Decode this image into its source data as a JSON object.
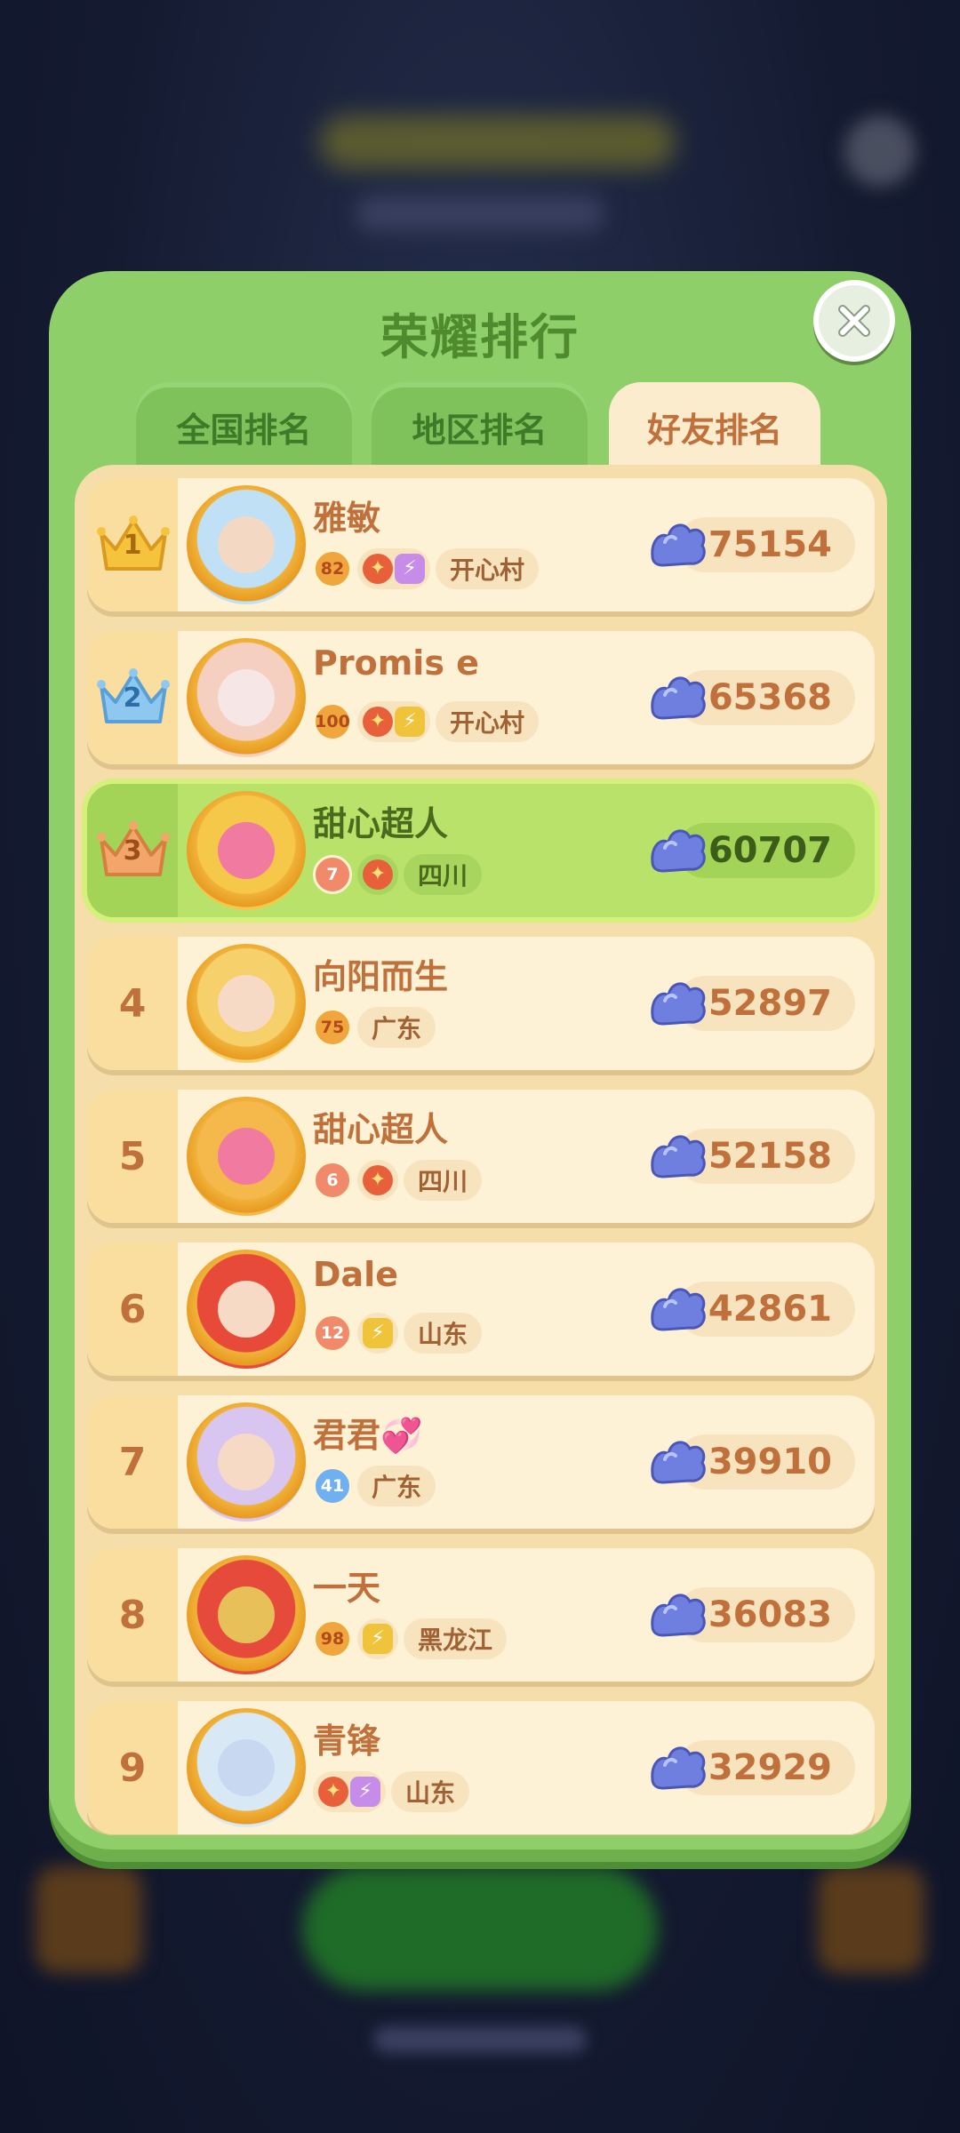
{
  "panel": {
    "title": "荣耀排行",
    "tabs": [
      {
        "label": "全国排名",
        "active": false
      },
      {
        "label": "地区排名",
        "active": false
      },
      {
        "label": "好友排名",
        "active": true
      }
    ]
  },
  "rankings": [
    {
      "rank": "1",
      "name": "雅敏",
      "level": "82",
      "icons": [
        "fire",
        "purple"
      ],
      "region": "开心村",
      "score": "75154",
      "crown": "gold"
    },
    {
      "rank": "2",
      "name": "Promis e",
      "level": "100",
      "icons": [
        "fire",
        "bolt"
      ],
      "region": "开心村",
      "score": "65368",
      "crown": "silver"
    },
    {
      "rank": "3",
      "name": "甜心超人",
      "level": "7",
      "icons": [
        "fire"
      ],
      "region": "四川",
      "score": "60707",
      "crown": "bronze",
      "highlight": true
    },
    {
      "rank": "4",
      "name": "向阳而生",
      "level": "75",
      "icons": [],
      "region": "广东",
      "score": "52897"
    },
    {
      "rank": "5",
      "name": "甜心超人",
      "level": "6",
      "icons": [
        "fire"
      ],
      "region": "四川",
      "score": "52158"
    },
    {
      "rank": "6",
      "name": "Dale",
      "level": "12",
      "icons": [
        "bolt"
      ],
      "region": "山东",
      "score": "42861"
    },
    {
      "rank": "7",
      "name": "君君💞",
      "level": "41",
      "icons": [],
      "region": "广东",
      "score": "39910"
    },
    {
      "rank": "8",
      "name": "一天",
      "level": "98",
      "icons": [
        "bolt"
      ],
      "region": "黑龙江",
      "score": "36083"
    },
    {
      "rank": "9",
      "name": "青锋",
      "level": "",
      "icons": [
        "fire",
        "purple"
      ],
      "region": "山东",
      "score": "32929"
    }
  ],
  "colors": {
    "panel_green": "#8fcf6a",
    "cream": "#fdf1d6",
    "highlight_green": "#b9e26a",
    "score_brown": "#c0703b"
  }
}
